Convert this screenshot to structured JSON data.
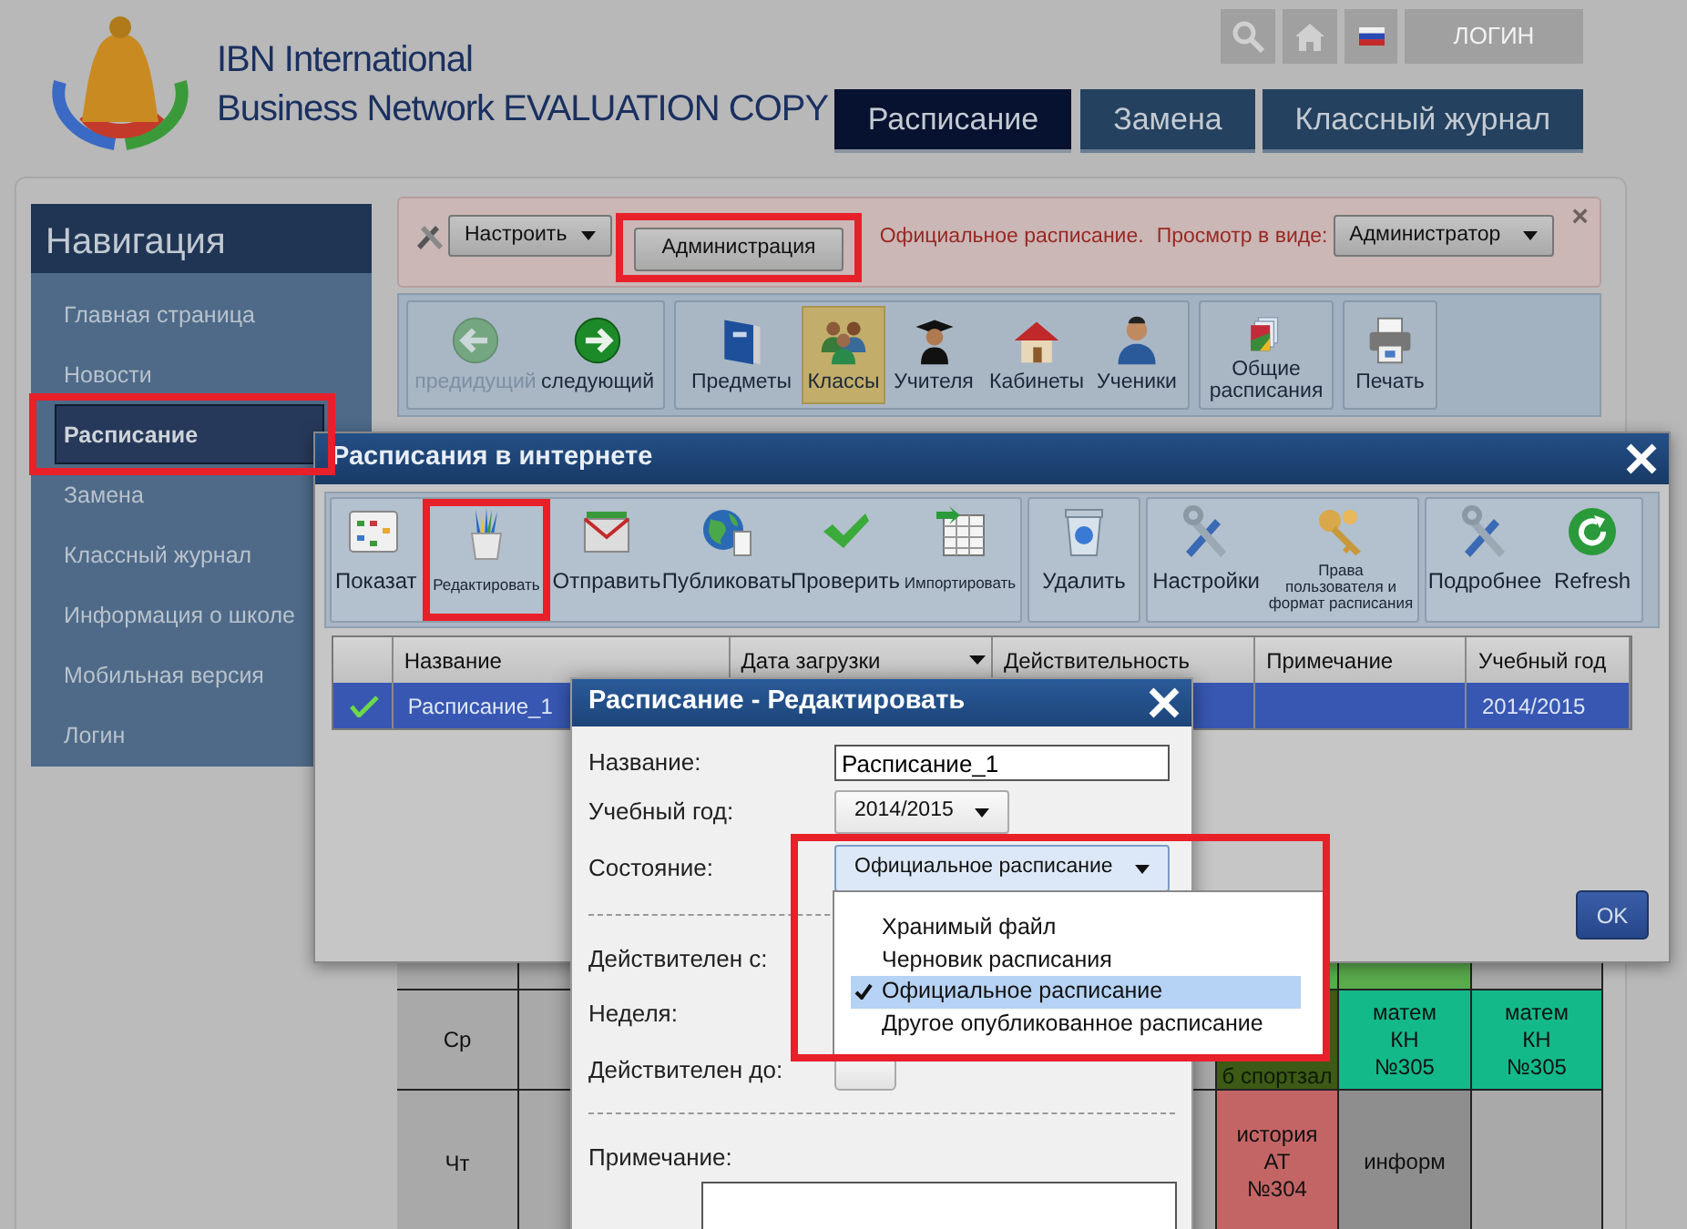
{
  "header": {
    "title_lines": [
      "IBN International",
      "Business Network EVALUATION COPY"
    ],
    "login": "ЛОГИН",
    "tabs": [
      {
        "label": "Расписание",
        "selected": true
      },
      {
        "label": "Замена",
        "selected": false
      },
      {
        "label": "Классный журнал",
        "selected": false
      }
    ]
  },
  "sidebar": {
    "title": "Навигация",
    "items": [
      {
        "label": "Главная страница",
        "selected": false,
        "highlighted": false
      },
      {
        "label": "Новости",
        "selected": false,
        "highlighted": false
      },
      {
        "label": "Расписание",
        "selected": true,
        "highlighted": true
      },
      {
        "label": "Замена",
        "selected": false,
        "highlighted": false
      },
      {
        "label": "Классный журнал",
        "selected": false,
        "highlighted": false
      },
      {
        "label": "Информация о школе",
        "selected": false,
        "highlighted": false
      },
      {
        "label": "Мобильная версия",
        "selected": false,
        "highlighted": false
      },
      {
        "label": "Логин",
        "selected": false,
        "highlighted": false
      }
    ]
  },
  "alert": {
    "configure": "Настроить",
    "admin_button": {
      "label": "Администрация",
      "highlighted": true
    },
    "status": "Официальное расписание.",
    "view_label": "Просмотр в виде:",
    "view_as": "Администратор",
    "close": "×"
  },
  "toolbar": {
    "groups": [
      {
        "buttons": [
          {
            "label": "предидущий",
            "disabled": true,
            "selected": false
          },
          {
            "label": "следующий",
            "disabled": false,
            "selected": false
          }
        ]
      },
      {
        "buttons": [
          {
            "label": "Предметы",
            "disabled": false,
            "selected": false
          },
          {
            "label": "Классы",
            "disabled": false,
            "selected": true
          },
          {
            "label": "Учителя",
            "disabled": false,
            "selected": false
          },
          {
            "label": "Кабинеты",
            "disabled": false,
            "selected": false
          },
          {
            "label": "Ученики",
            "disabled": false,
            "selected": false
          }
        ]
      },
      {
        "buttons": [
          {
            "label": "Общие расписания",
            "disabled": false,
            "selected": false
          }
        ]
      },
      {
        "buttons": [
          {
            "label": "Печать",
            "disabled": false,
            "selected": false
          }
        ]
      }
    ]
  },
  "timetable": {
    "rows": [
      {
        "cells": [
          {
            "color": "#5aab4c"
          },
          {
            "color": "#5aab4c"
          },
          {
            "color": "#a9a9a9"
          }
        ]
      },
      {
        "day": "Ср",
        "cells": [
          {
            "color": "#3d5a16",
            "lines": [
              "б спортзал"
            ],
            "partial": true
          },
          {
            "color": "#14b98a",
            "lines": [
              "матем",
              "КН",
              "№305"
            ]
          },
          {
            "color": "#14b98a",
            "lines": [
              "матем",
              "КН",
              "№305"
            ]
          }
        ]
      },
      {
        "day": "Чт",
        "cells": [
          {
            "color": "#c46565",
            "lines": [
              "история",
              "АТ",
              "№304"
            ]
          },
          {
            "color": "#8e8e8e",
            "lines": [
              "информ"
            ]
          },
          {
            "color": "#a9a9a9"
          }
        ]
      }
    ]
  },
  "dialog": {
    "title": "Расписания в интернете",
    "toolbar": {
      "groups": [
        {
          "buttons": [
            {
              "label": "Показат",
              "small": false,
              "highlighted": false
            },
            {
              "label": "Редактировать",
              "small": true,
              "highlighted": true
            },
            {
              "label": "Отправить",
              "small": false,
              "highlighted": false
            },
            {
              "label": "Публиковать",
              "small": false,
              "highlighted": false
            },
            {
              "label": "Проверить",
              "small": false,
              "highlighted": false
            },
            {
              "label": "Импортировать",
              "small": true,
              "highlighted": false
            }
          ]
        },
        {
          "buttons": [
            {
              "label": "Удалить",
              "small": false,
              "highlighted": false
            }
          ]
        },
        {
          "buttons": [
            {
              "label": "Настройки",
              "small": false,
              "highlighted": false
            },
            {
              "label": "Права пользователя и формат расписания",
              "small": true,
              "highlighted": false
            }
          ]
        },
        {
          "buttons": [
            {
              "label": "Подробнее",
              "small": false,
              "highlighted": false
            },
            {
              "label": "Refresh",
              "small": false,
              "highlighted": false
            }
          ]
        }
      ]
    },
    "table": {
      "columns": [
        {
          "label": "Название",
          "sorted": false
        },
        {
          "label": "Дата загрузки",
          "sorted": true
        },
        {
          "label": "Действительность",
          "sorted": false
        },
        {
          "label": "Примечание",
          "sorted": false
        },
        {
          "label": "Учебный год",
          "sorted": false
        }
      ],
      "rows": [
        {
          "selected": true,
          "checked": true,
          "name": "Расписание_1",
          "school_year": "2014/2015"
        }
      ]
    },
    "ok": "OK"
  },
  "editor": {
    "title": "Расписание - Редактировать",
    "fields": [
      {
        "kind": "input",
        "label": "Название:",
        "value": "Расписание_1"
      },
      {
        "kind": "select",
        "label": "Учебный год:",
        "value": "2014/2015",
        "highlighted": false
      },
      {
        "kind": "select",
        "label": "Состояние:",
        "value": "Официальное расписание",
        "highlighted": true
      },
      {
        "kind": "separator"
      },
      {
        "kind": "label",
        "label": "Действителен с:"
      },
      {
        "kind": "label",
        "label": "Неделя:"
      },
      {
        "kind": "date",
        "label": "Действителен до:"
      },
      {
        "kind": "separator"
      },
      {
        "kind": "textarea",
        "label": "Примечание:"
      }
    ],
    "dropdown": {
      "options": [
        {
          "label": "Хранимый файл",
          "selected": false
        },
        {
          "label": "Черновик расписания",
          "selected": false
        },
        {
          "label": "Официальное расписание",
          "selected": true
        },
        {
          "label": "Другое опубликованное расписание",
          "selected": false
        }
      ]
    }
  }
}
